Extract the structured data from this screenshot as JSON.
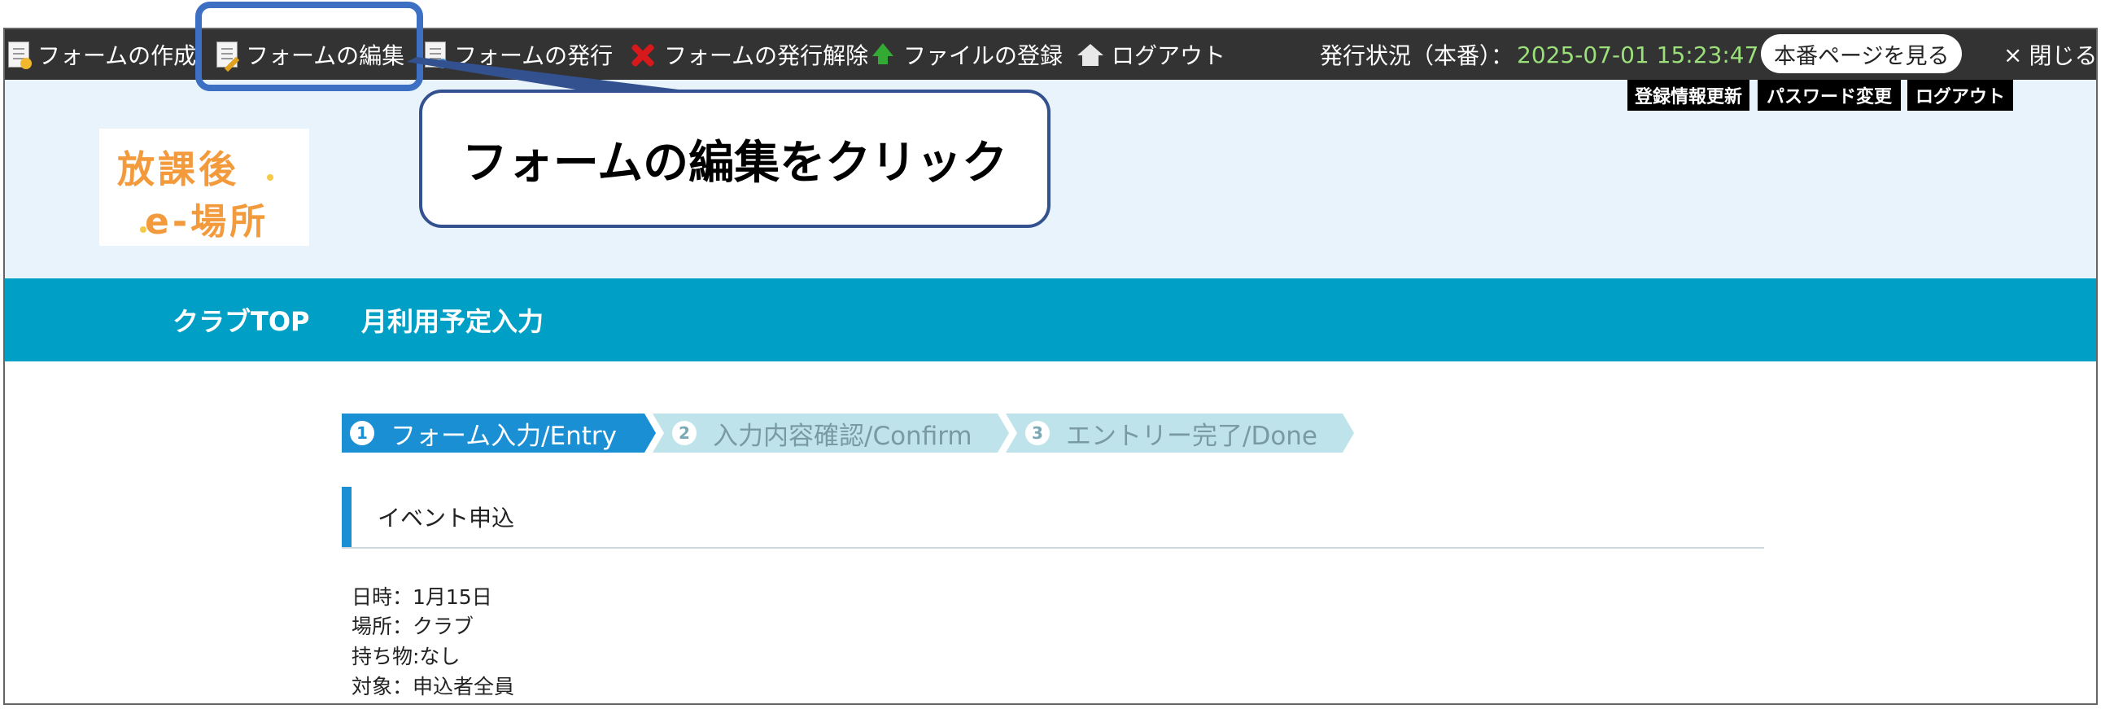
{
  "toolbar": {
    "items": [
      {
        "label": "フォームの作成",
        "icon": "form-add-icon"
      },
      {
        "label": "フォームの編集",
        "icon": "form-edit-icon"
      },
      {
        "label": "フォームの発行",
        "icon": "form-publish-icon"
      },
      {
        "label": "フォームの発行解除",
        "icon": "unpublish-x-icon"
      },
      {
        "label": "ファイルの登録",
        "icon": "upload-arrow-icon"
      },
      {
        "label": "ログアウト",
        "icon": "home-icon"
      }
    ],
    "status_label": "発行状況（本番）：",
    "status_time": "2025-07-01 15:23:47",
    "view_button": "本番ページを見る",
    "close_glyph": "×",
    "close_label": "閉じる"
  },
  "header": {
    "logo_line1": "放課後",
    "logo_line2": "e-場所",
    "buttons": [
      "登録情報更新",
      "パスワード変更",
      "ログアウト"
    ]
  },
  "nav": {
    "items": [
      "クラブTOP",
      "月利用予定入力"
    ]
  },
  "steps": [
    {
      "num": "1",
      "label": "フォーム入力/Entry",
      "state": "active"
    },
    {
      "num": "2",
      "label": "入力内容確認/Confirm",
      "state": "inactive"
    },
    {
      "num": "3",
      "label": "エントリー完了/Done",
      "state": "inactive"
    }
  ],
  "form": {
    "title": "イベント申込",
    "lines": [
      "日時：1月15日",
      "場所：クラブ",
      "持ち物:なし",
      "対象：申込者全員"
    ]
  },
  "callout": {
    "text": "フォームの編集をクリック"
  },
  "colors": {
    "toolbar_bg": "#333333",
    "header_bg": "#e8f3fc",
    "nav_bg": "#00a0c6",
    "step_active": "#1a8fd3",
    "step_inactive": "#bfe3ea",
    "status_time": "#9be07a",
    "highlight": "#3d6fc2"
  }
}
